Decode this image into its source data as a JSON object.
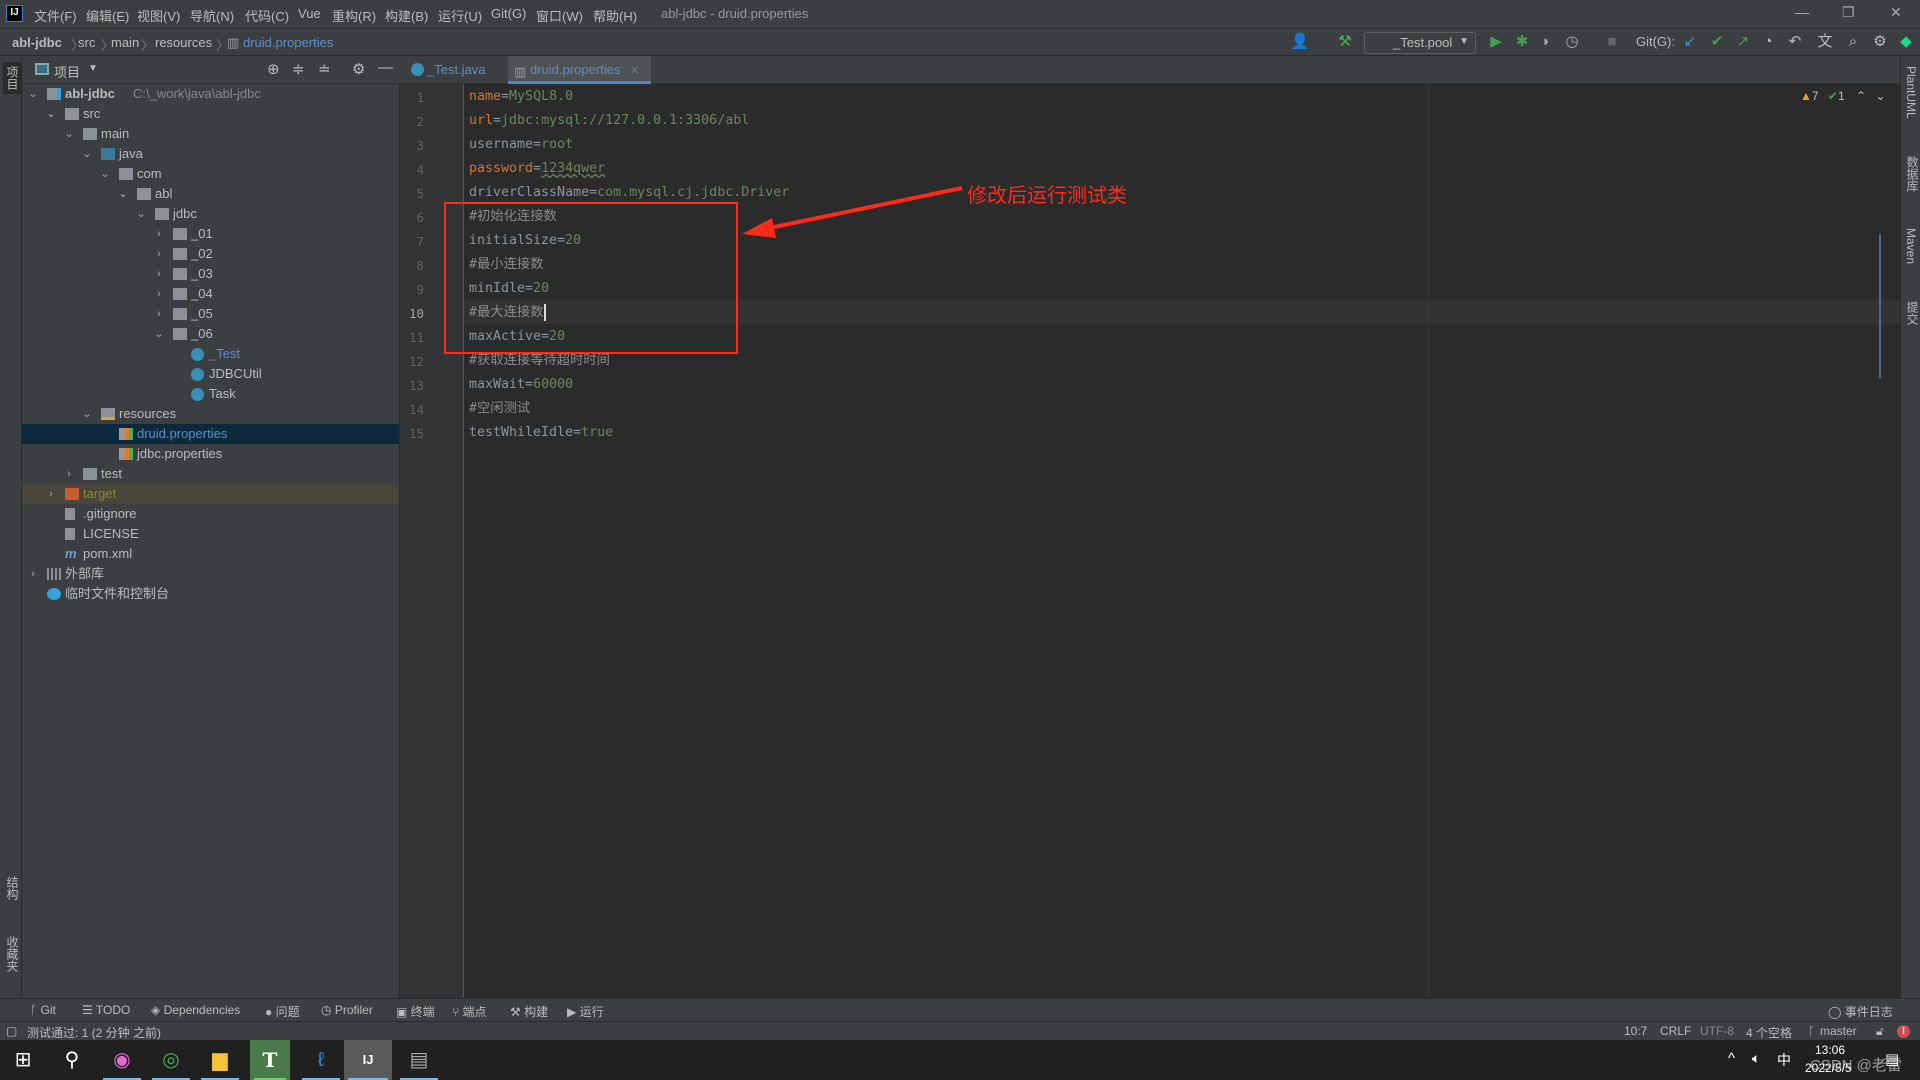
{
  "window": {
    "title": "abl-jdbc - druid.properties",
    "app_logo": "IJ"
  },
  "menu": [
    "文件(F)",
    "编辑(E)",
    "视图(V)",
    "导航(N)",
    "代码(C)",
    "Vue",
    "重构(R)",
    "构建(B)",
    "运行(U)",
    "Git(G)",
    "窗口(W)",
    "帮助(H)"
  ],
  "breadcrumb": [
    "abl-jdbc",
    "src",
    "main",
    "resources",
    "druid.properties"
  ],
  "toolbar": {
    "run_config": "_Test.pool",
    "git_label": "Git(G):"
  },
  "project_panel": {
    "title": "项目",
    "root_path": "C:\\_work\\java\\abl-jdbc"
  },
  "tree": [
    {
      "d": 0,
      "a": "open",
      "i": "module",
      "label": "abl-jdbc",
      "bold": true
    },
    {
      "d": 1,
      "a": "open",
      "i": "folder",
      "label": "src"
    },
    {
      "d": 2,
      "a": "open",
      "i": "folder",
      "label": "main"
    },
    {
      "d": 3,
      "a": "open",
      "i": "src-folder",
      "label": "java"
    },
    {
      "d": 4,
      "a": "open",
      "i": "package",
      "label": "com"
    },
    {
      "d": 5,
      "a": "open",
      "i": "package",
      "label": "abl"
    },
    {
      "d": 6,
      "a": "open",
      "i": "package",
      "label": "jdbc"
    },
    {
      "d": 7,
      "a": "closed",
      "i": "package",
      "label": "_01"
    },
    {
      "d": 7,
      "a": "closed",
      "i": "package",
      "label": "_02"
    },
    {
      "d": 7,
      "a": "closed",
      "i": "package",
      "label": "_03"
    },
    {
      "d": 7,
      "a": "closed",
      "i": "package",
      "label": "_04"
    },
    {
      "d": 7,
      "a": "closed",
      "i": "package",
      "label": "_05"
    },
    {
      "d": 7,
      "a": "open",
      "i": "package",
      "label": "_06"
    },
    {
      "d": 8,
      "a": "none",
      "i": "class",
      "label": "_Test",
      "color": "#5f8dc7"
    },
    {
      "d": 8,
      "a": "none",
      "i": "class",
      "label": "JDBCUtil"
    },
    {
      "d": 8,
      "a": "none",
      "i": "class",
      "label": "Task"
    },
    {
      "d": 3,
      "a": "open",
      "i": "res-folder",
      "label": "resources"
    },
    {
      "d": 4,
      "a": "none",
      "i": "properties",
      "label": "druid.properties",
      "selected": true,
      "color": "#5f8dc7"
    },
    {
      "d": 4,
      "a": "none",
      "i": "properties",
      "label": "jdbc.properties"
    },
    {
      "d": 2,
      "a": "closed",
      "i": "folder",
      "label": "test"
    },
    {
      "d": 1,
      "a": "closed",
      "i": "excluded-folder",
      "label": "target",
      "excluded": true,
      "color": "#8a8a2a"
    },
    {
      "d": 1,
      "a": "none",
      "i": "file",
      "label": ".gitignore"
    },
    {
      "d": 1,
      "a": "none",
      "i": "file",
      "label": "LICENSE"
    },
    {
      "d": 1,
      "a": "none",
      "i": "maven",
      "label": "pom.xml"
    },
    {
      "d": 0,
      "a": "closed",
      "i": "library",
      "label": "外部库"
    },
    {
      "d": 0,
      "a": "none",
      "i": "scratch",
      "label": "临时文件和控制台"
    }
  ],
  "tabs": [
    {
      "label": "_Test.java",
      "active": false
    },
    {
      "label": "druid.properties",
      "active": true
    }
  ],
  "inspections": {
    "warnings": "7",
    "ok": "1"
  },
  "code": [
    {
      "k": "name",
      "kc": "k",
      "v": "MySQL8.0"
    },
    {
      "k": "url",
      "kc": "k",
      "v": "jdbc:mysql://127.0.0.1:3306/abl"
    },
    {
      "k": "username",
      "kc": "kg",
      "v": "root"
    },
    {
      "k": "password",
      "kc": "k",
      "v": "1234qwer"
    },
    {
      "k": "driverClassName",
      "kc": "kg",
      "v": "com.mysql.cj.jdbc.Driver"
    },
    {
      "c": "#初始化连接数"
    },
    {
      "k": "initialSize",
      "kc": "kg",
      "v": "20"
    },
    {
      "c": "#最小连接数"
    },
    {
      "k": "minIdle",
      "kc": "kg",
      "v": "20"
    },
    {
      "c": "#最大连接数"
    },
    {
      "k": "maxActive",
      "kc": "kg",
      "v": "20"
    },
    {
      "c": "#获取连接等待超时时间"
    },
    {
      "k": "maxWait",
      "kc": "kg",
      "v": "60000"
    },
    {
      "c": "#空闲测试"
    },
    {
      "k": "testWhileIdle",
      "kc": "kg",
      "v": "true"
    }
  ],
  "current_line": 10,
  "annotation": {
    "text": "修改后运行测试类",
    "color": "#ff2a1a"
  },
  "left_stripe": {
    "top": "项目",
    "bottom1": "结构",
    "bottom2": "收藏夹"
  },
  "right_stripe": [
    "PlantUML",
    "数据库",
    "Maven",
    "提交"
  ],
  "bottom_tools": [
    "Git",
    "TODO",
    "Dependencies",
    "问题",
    "Profiler",
    "终端",
    "端点",
    "构建",
    "运行"
  ],
  "event_log": "事件日志",
  "status": {
    "message": "测试通过: 1 (2 分钟 之前)",
    "position": "10:7",
    "line_sep": "CRLF",
    "encoding": "UTF-8",
    "indent": "4 个空格",
    "branch": "master"
  },
  "taskbar": {
    "time": "13:06",
    "date": "2022/5/5",
    "ime": "中",
    "watermark": "CSDN @老雷"
  }
}
